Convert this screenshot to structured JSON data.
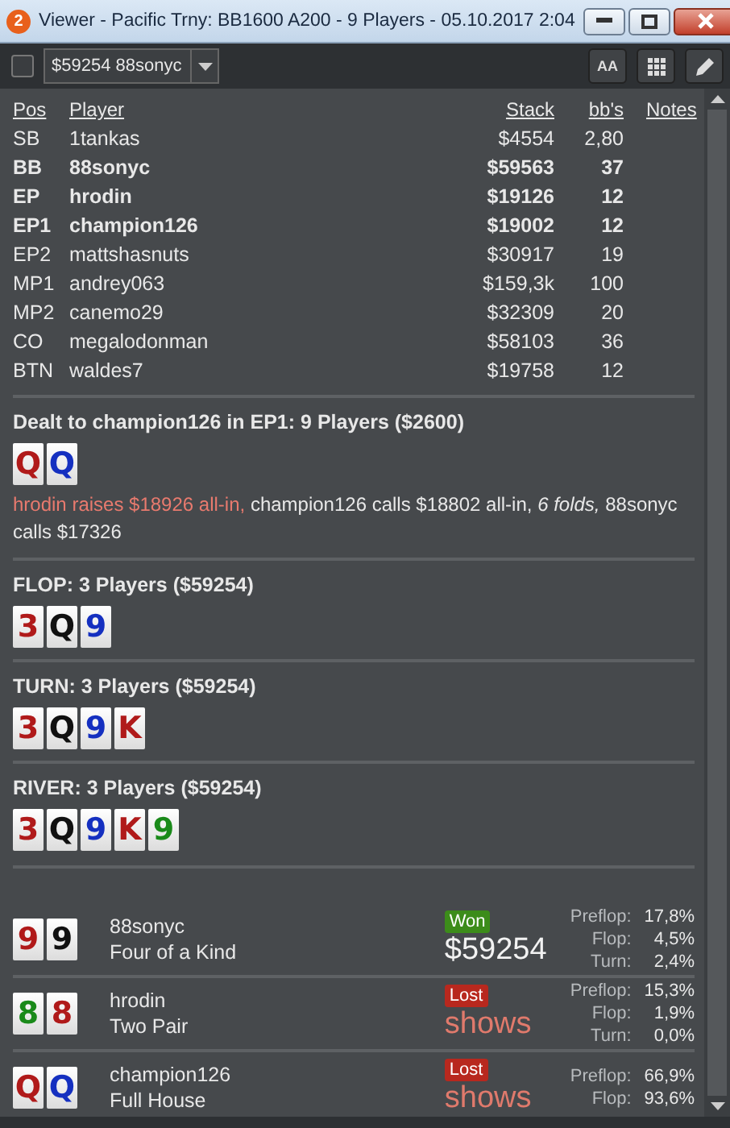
{
  "window": {
    "app_badge": "2",
    "title": "Viewer - Pacific Trny: BB1600 A200 - 9 Players - 05.10.2017 2:04"
  },
  "toolbar": {
    "checked": false,
    "hand_select": "$59254 88sonyc",
    "font_button": "AA"
  },
  "players": {
    "columns": [
      "Pos",
      "Player",
      "Stack",
      "bb's",
      "Notes"
    ],
    "rows": [
      {
        "pos": "SB",
        "player": "1tankas",
        "stack": "$4554",
        "bbs": "2,80",
        "highlighted": false
      },
      {
        "pos": "BB",
        "player": "88sonyc",
        "stack": "$59563",
        "bbs": "37",
        "highlighted": true
      },
      {
        "pos": "EP",
        "player": "hrodin",
        "stack": "$19126",
        "bbs": "12",
        "highlighted": true
      },
      {
        "pos": "EP1",
        "player": "champion126",
        "stack": "$19002",
        "bbs": "12",
        "highlighted": true
      },
      {
        "pos": "EP2",
        "player": "mattshasnuts",
        "stack": "$30917",
        "bbs": "19",
        "highlighted": false
      },
      {
        "pos": "MP1",
        "player": "andrey063",
        "stack": "$159,3k",
        "bbs": "100",
        "highlighted": false
      },
      {
        "pos": "MP2",
        "player": "canemo29",
        "stack": "$32309",
        "bbs": "20",
        "highlighted": false
      },
      {
        "pos": "CO",
        "player": "megalodonman",
        "stack": "$58103",
        "bbs": "36",
        "highlighted": false
      },
      {
        "pos": "BTN",
        "player": "waldes7",
        "stack": "$19758",
        "bbs": "12",
        "highlighted": false
      }
    ]
  },
  "streets": [
    {
      "heading": "Dealt to champion126 in EP1: 9 Players ($2600)",
      "cards": [
        {
          "rank": "Q",
          "color": "#b01a1a"
        },
        {
          "rank": "Q",
          "color": "#1530c0"
        }
      ],
      "action": [
        {
          "kind": "aggressive",
          "text": "hrodin raises $18926 all-in,"
        },
        {
          "kind": "plain",
          "text": "champion126 calls $18802 all-in, *6 folds,* 88sonyc calls $17326"
        }
      ]
    },
    {
      "heading": "FLOP: 3 Players ($59254)",
      "cards": [
        {
          "rank": "3",
          "color": "#b01a1a"
        },
        {
          "rank": "Q",
          "color": "#111111"
        },
        {
          "rank": "9",
          "color": "#1530c0"
        }
      ]
    },
    {
      "heading": "TURN: 3 Players ($59254)",
      "cards": [
        {
          "rank": "3",
          "color": "#b01a1a"
        },
        {
          "rank": "Q",
          "color": "#111111"
        },
        {
          "rank": "9",
          "color": "#1530c0"
        },
        {
          "rank": "K",
          "color": "#b01a1a"
        }
      ]
    },
    {
      "heading": "RIVER: 3 Players ($59254)",
      "cards": [
        {
          "rank": "3",
          "color": "#b01a1a"
        },
        {
          "rank": "Q",
          "color": "#111111"
        },
        {
          "rank": "9",
          "color": "#1530c0"
        },
        {
          "rank": "K",
          "color": "#b01a1a"
        },
        {
          "rank": "9",
          "color": "#1a8a1a"
        }
      ]
    }
  ],
  "results": [
    {
      "cards": [
        {
          "rank": "9",
          "color": "#b01a1a"
        },
        {
          "rank": "9",
          "color": "#111111"
        }
      ],
      "player": "88sonyc",
      "hand": "Four of a Kind",
      "kind": "won",
      "badge": "Won",
      "amount": "$59254",
      "stats": [
        {
          "label": "Preflop:",
          "value": "17,8%"
        },
        {
          "label": "Flop:",
          "value": "4,5%"
        },
        {
          "label": "Turn:",
          "value": "2,4%"
        }
      ]
    },
    {
      "cards": [
        {
          "rank": "8",
          "color": "#1a8a1a"
        },
        {
          "rank": "8",
          "color": "#b01a1a"
        }
      ],
      "player": "hrodin",
      "hand": "Two Pair",
      "kind": "lost",
      "badge": "Lost",
      "amount": "shows",
      "stats": [
        {
          "label": "Preflop:",
          "value": "15,3%"
        },
        {
          "label": "Flop:",
          "value": "1,9%"
        },
        {
          "label": "Turn:",
          "value": "0,0%"
        }
      ]
    },
    {
      "cards": [
        {
          "rank": "Q",
          "color": "#b01a1a"
        },
        {
          "rank": "Q",
          "color": "#1530c0"
        }
      ],
      "player": "champion126",
      "hand": "Full House",
      "kind": "lost",
      "badge": "Lost",
      "amount": "shows",
      "stats": [
        {
          "label": "Preflop:",
          "value": "66,9%"
        },
        {
          "label": "Flop:",
          "value": "93,6%"
        }
      ]
    }
  ]
}
